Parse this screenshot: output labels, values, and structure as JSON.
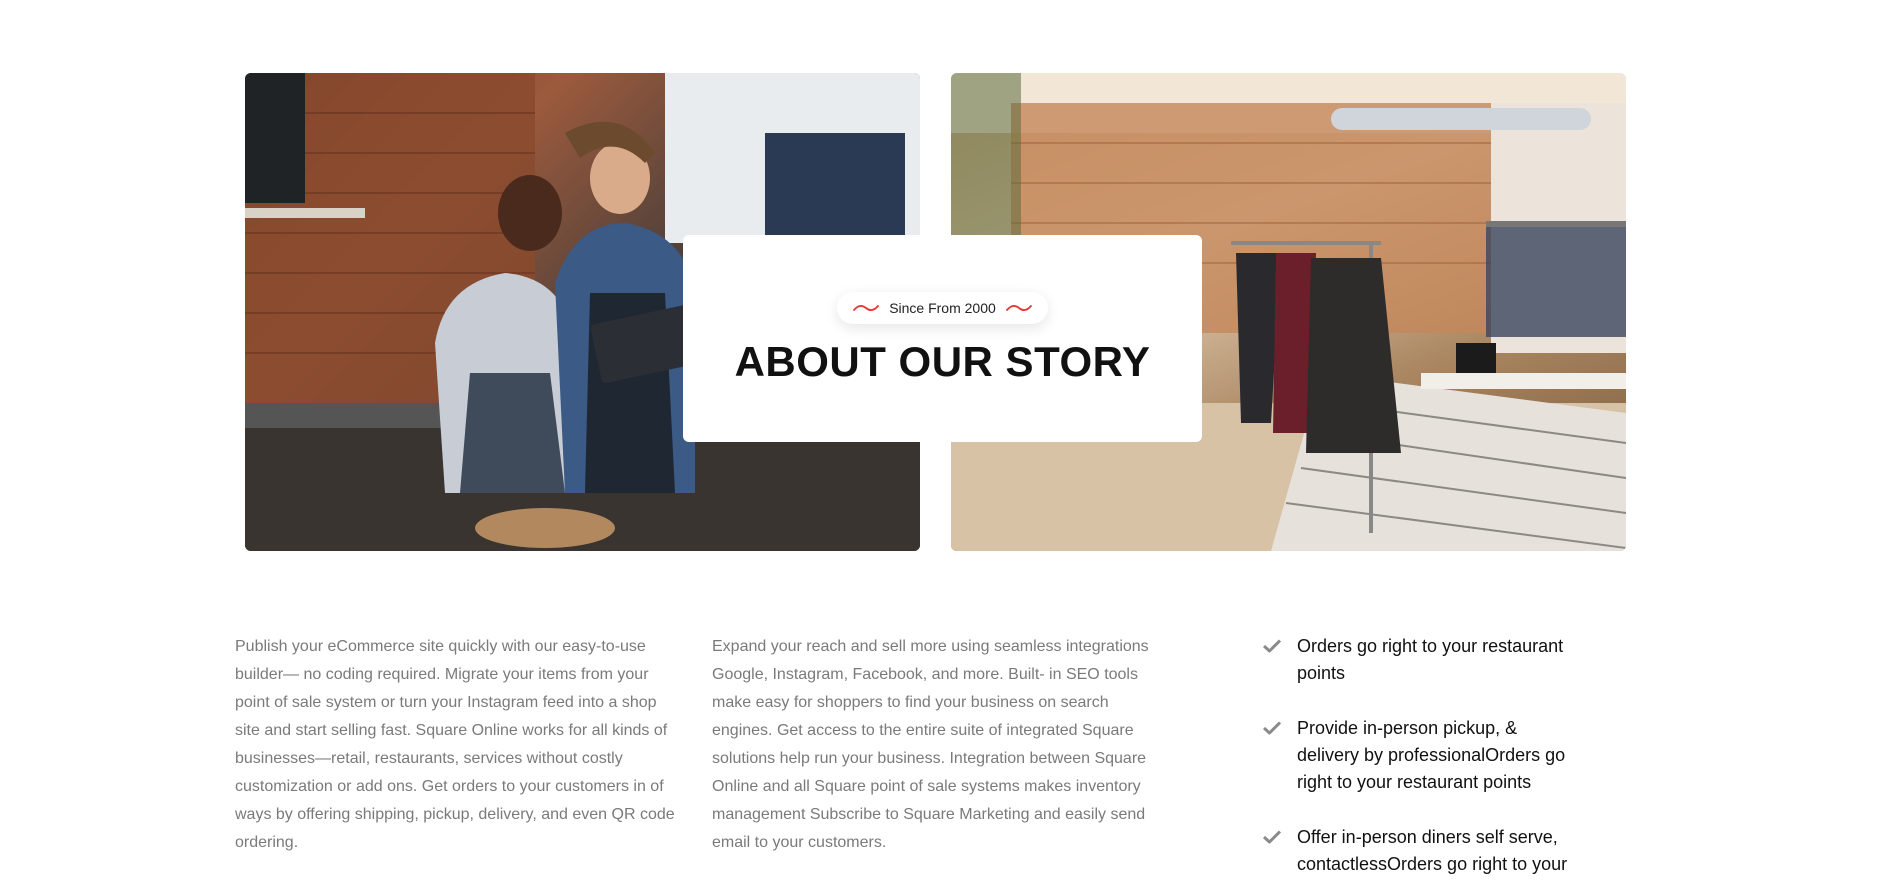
{
  "hero": {
    "since_label": "Since From 2000",
    "title": "ABOUT OUR STORY",
    "accent_color": "#e53935",
    "left_image": "cafe-team-photo",
    "right_image": "clothing-store-photo"
  },
  "columns": {
    "paragraph_1": "Publish your eCommerce site quickly with our easy-to-use builder— no coding required. Migrate your items from your point of sale system or turn your Instagram feed into a shop site and start selling fast. Square Online works for all kinds of businesses—retail, restaurants, services without costly customization or add ons. Get orders to your customers in of ways by offering shipping, pickup, delivery, and even QR code ordering.",
    "paragraph_2": "Expand your reach and sell more using seamless integrations Google, Instagram, Facebook, and more. Built- in SEO tools make easy for shoppers to find your business on search engines. Get access to the entire suite of integrated Square solutions help run your business. Integration between Square Online and all Square point of sale systems makes inventory management Subscribe to Square Marketing and easily send email to your customers."
  },
  "features": [
    {
      "icon": "check-icon",
      "text": "Orders go right to your restaurant points"
    },
    {
      "icon": "check-icon",
      "text": "Provide in-person pickup, & delivery by professionalOrders go right to your restaurant points"
    },
    {
      "icon": "check-icon",
      "text": "Offer in-person diners self serve, contactlessOrders go right to your"
    }
  ]
}
